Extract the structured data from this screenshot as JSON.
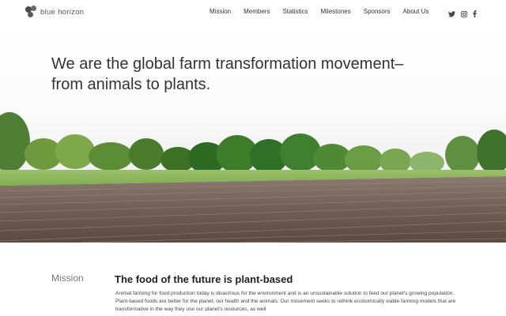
{
  "brand": {
    "name": "blue horizon"
  },
  "nav": {
    "items": [
      {
        "label": "Mission"
      },
      {
        "label": "Members"
      },
      {
        "label": "Statistics"
      },
      {
        "label": "Milestones"
      },
      {
        "label": "Sponsors"
      },
      {
        "label": "About Us"
      }
    ]
  },
  "social": {
    "icons": [
      "twitter-icon",
      "instagram-icon",
      "facebook-icon"
    ]
  },
  "hero": {
    "headline": "We are the global farm transformation movement– from animals to plants."
  },
  "mission": {
    "label": "Mission",
    "title": "The food of the future is plant-based",
    "body": "Animal farming for food production today is disastrous for the environment and is an unsustainable solution to feed our planet's growing population. Plant-based foods are better for the planet, our health and the animals. Our movement seeks to rethink economically viable farming models that are transformative in the way they use our planet's resources, as well"
  }
}
